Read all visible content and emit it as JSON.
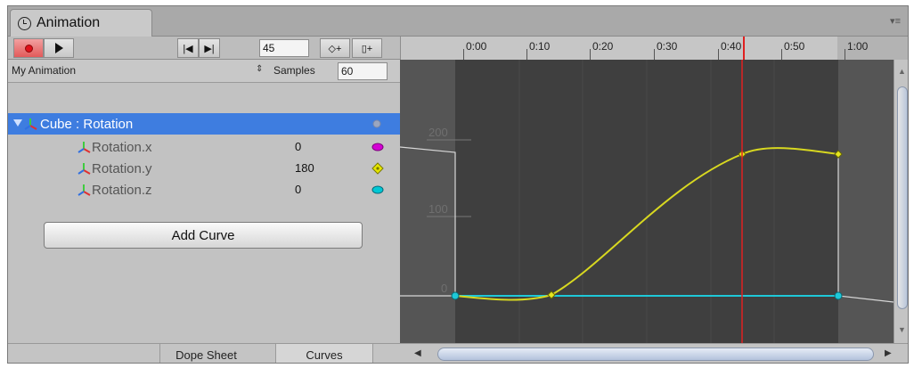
{
  "window": {
    "tab_title": "Animation",
    "menu_glyph": "▾≡"
  },
  "toolbar": {
    "record_icon": "record-icon",
    "play_icon": "play-icon",
    "prev_key_glyph": "|◀",
    "next_key_glyph": "▶|",
    "frame": "45",
    "add_keyframe_glyph": "◇+",
    "add_event_glyph": "▯+"
  },
  "timeline": {
    "ticks": [
      "0:00",
      "0:10",
      "0:20",
      "0:30",
      "0:40",
      "0:50",
      "1:00"
    ],
    "playhead_label": "0:45"
  },
  "clip": {
    "name": "My Animation",
    "arrow": "⇕",
    "samples_label": "Samples",
    "samples_value": "60"
  },
  "properties": [
    {
      "label": "Cube : Rotation",
      "value": "",
      "color": "#9aa6c0"
    },
    {
      "label": "Rotation.x",
      "value": "0",
      "color": "#d400d4"
    },
    {
      "label": "Rotation.y",
      "value": "180",
      "color": "#e6e600"
    },
    {
      "label": "Rotation.z",
      "value": "0",
      "color": "#00c8d4"
    }
  ],
  "add_curve_label": "Add Curve",
  "view_tabs": {
    "dope_sheet": "Dope Sheet",
    "curves": "Curves"
  },
  "curve_view": {
    "y_labels": [
      "200",
      "100",
      "0"
    ],
    "colors": {
      "rotation_y": "#d8d820",
      "rotation_xz": "#1ec8d8",
      "playhead": "#e02020",
      "outside_curve": "#d8d8d8"
    }
  }
}
